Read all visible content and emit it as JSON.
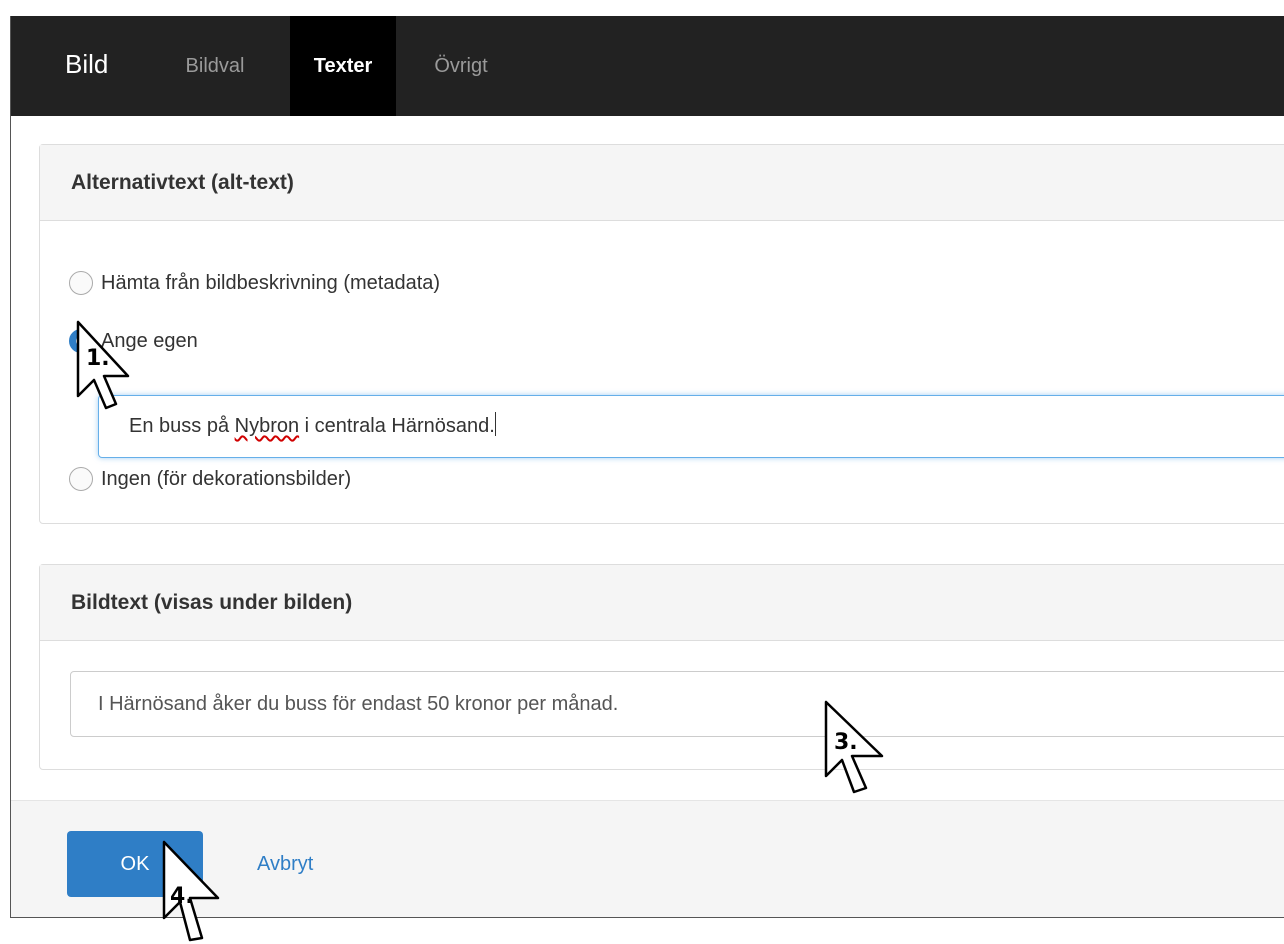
{
  "header": {
    "title": "Bild",
    "tabs": [
      {
        "label": "Bildval",
        "active": false
      },
      {
        "label": "Texter",
        "active": true
      },
      {
        "label": "Övrigt",
        "active": false
      }
    ]
  },
  "alt_text_panel": {
    "title": "Alternativtext (alt-text)",
    "options": [
      {
        "label": "Hämta från bildbeskrivning (metadata)",
        "checked": false
      },
      {
        "label": "Ange egen",
        "checked": true
      },
      {
        "label": "Ingen (för dekorationsbilder)",
        "checked": false
      }
    ],
    "input": {
      "pre": "En buss på ",
      "misspelled": "Nybron",
      "post": " i centrala Härnösand."
    }
  },
  "caption_panel": {
    "title": "Bildtext (visas under bilden)",
    "input_value": "I Härnösand åker du buss för endast 50 kronor per månad."
  },
  "footer": {
    "ok_label": "OK",
    "cancel_label": "Avbryt"
  },
  "steps": {
    "one": "1.",
    "three": "3.",
    "four": "4."
  },
  "colors": {
    "accent": "#2f7ec6",
    "topbar": "#222222",
    "active_tab": "#000000"
  }
}
